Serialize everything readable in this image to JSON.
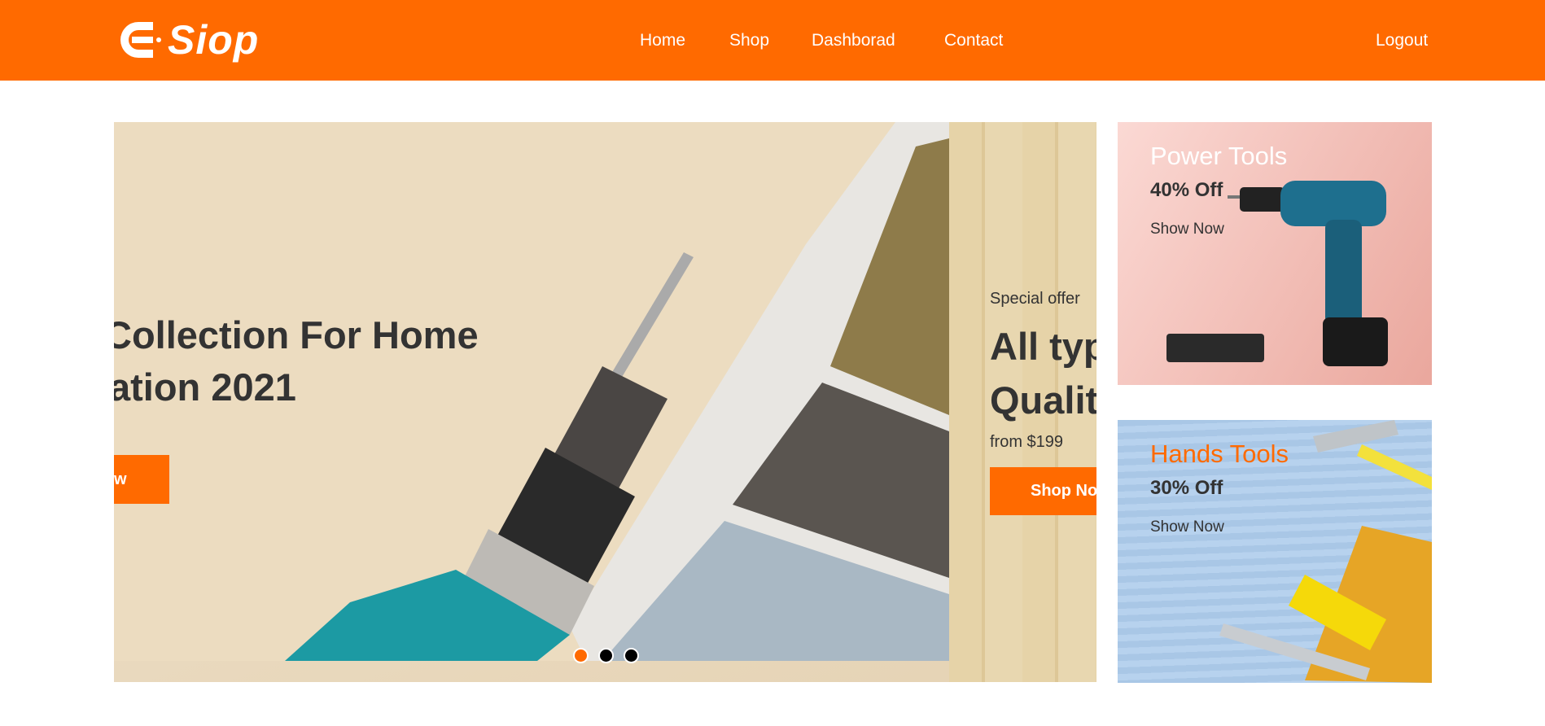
{
  "header": {
    "logo_text": "Siop",
    "nav": [
      "Home",
      "Shop",
      "Dashborad",
      "Contact"
    ],
    "logout": "Logout",
    "brand_color": "#ff6a00"
  },
  "slider": {
    "slide1": {
      "line1": "Collection For Home",
      "line2": "ation 2021",
      "button": "w"
    },
    "slide2": {
      "eyebrow": "Special offer",
      "line1": "All typ",
      "line2": "Qualit",
      "price": "from $199",
      "button": "Shop No"
    },
    "dots": 3,
    "active_dot": 0
  },
  "banners": [
    {
      "title": "Power Tools",
      "discount": "40% Off",
      "link": "Show Now",
      "title_color": "#ffffff"
    },
    {
      "title": "Hands Tools",
      "discount": "30% Off",
      "link": "Show Now",
      "title_color": "#ff6a00"
    }
  ]
}
